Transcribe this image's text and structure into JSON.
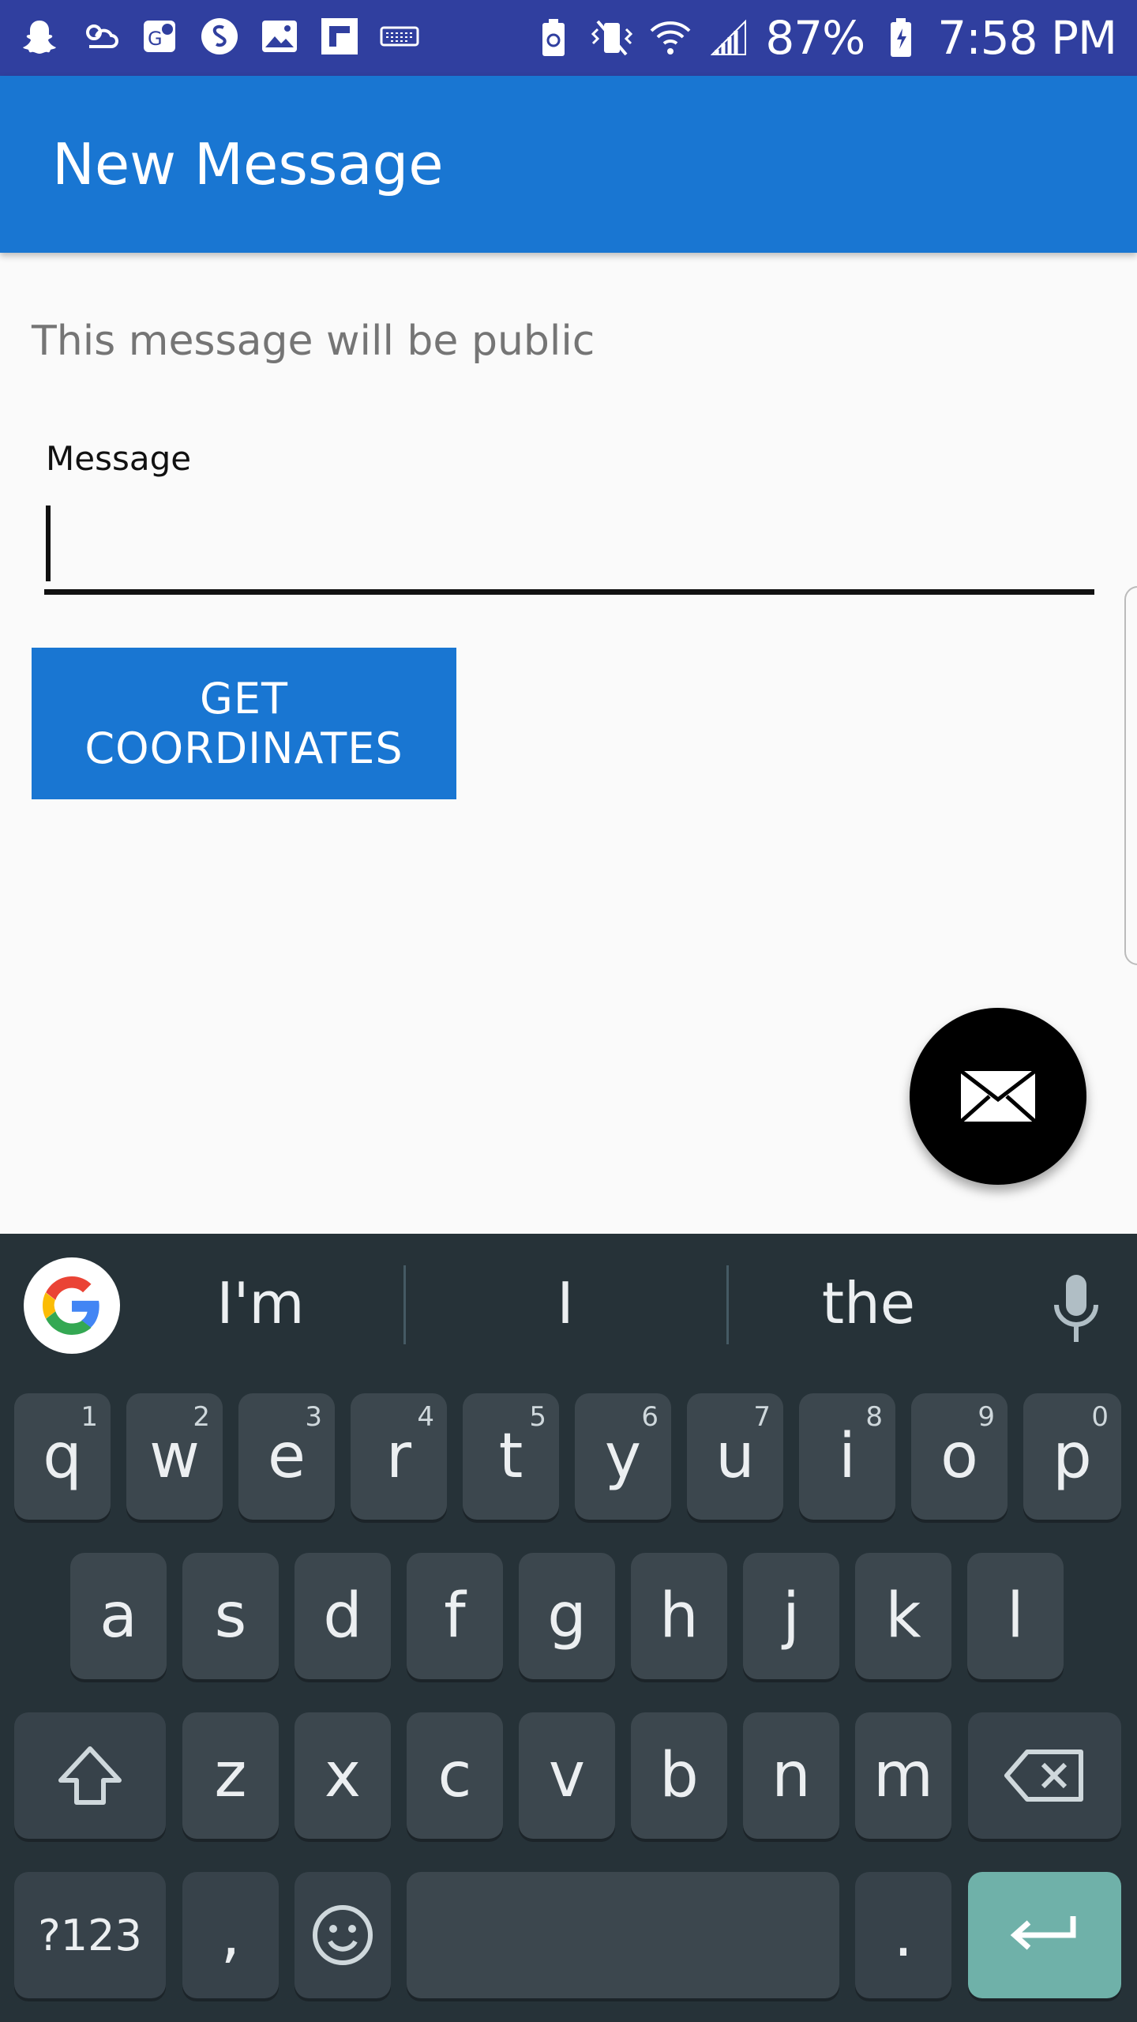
{
  "status_bar": {
    "left_icons": [
      "snapchat-icon",
      "weather-icon",
      "maps-icon",
      "shazam-icon",
      "gallery-icon",
      "flipboard-icon",
      "keyboard-icon"
    ],
    "right_icons": [
      "battery-saver-icon",
      "vibrate-icon",
      "wifi-icon",
      "signal-icon"
    ],
    "battery": "87%",
    "time": "7:58 PM"
  },
  "app_bar": {
    "title": "New Message"
  },
  "main": {
    "notice": "This message will be public",
    "message_label": "Message",
    "message_value": "",
    "get_coordinates_label": "GET COORDINATES"
  },
  "fab": {
    "icon": "envelope-icon"
  },
  "keyboard": {
    "suggestions": [
      "I'm",
      "I",
      "the"
    ],
    "row1": [
      {
        "key": "q",
        "hint": "1"
      },
      {
        "key": "w",
        "hint": "2"
      },
      {
        "key": "e",
        "hint": "3"
      },
      {
        "key": "r",
        "hint": "4"
      },
      {
        "key": "t",
        "hint": "5"
      },
      {
        "key": "y",
        "hint": "6"
      },
      {
        "key": "u",
        "hint": "7"
      },
      {
        "key": "i",
        "hint": "8"
      },
      {
        "key": "o",
        "hint": "9"
      },
      {
        "key": "p",
        "hint": "0"
      }
    ],
    "row2": [
      "a",
      "s",
      "d",
      "f",
      "g",
      "h",
      "j",
      "k",
      "l"
    ],
    "row3": [
      "z",
      "x",
      "c",
      "v",
      "b",
      "n",
      "m"
    ],
    "symbols_label": "?123",
    "comma_label": ",",
    "period_label": ".",
    "colors": {
      "background": "#263238",
      "key": "#3c474e",
      "enter": "#6fb1a9"
    }
  },
  "colors": {
    "primary": "#1976d2",
    "status_bar": "#303f9f",
    "background": "#fafafa"
  }
}
